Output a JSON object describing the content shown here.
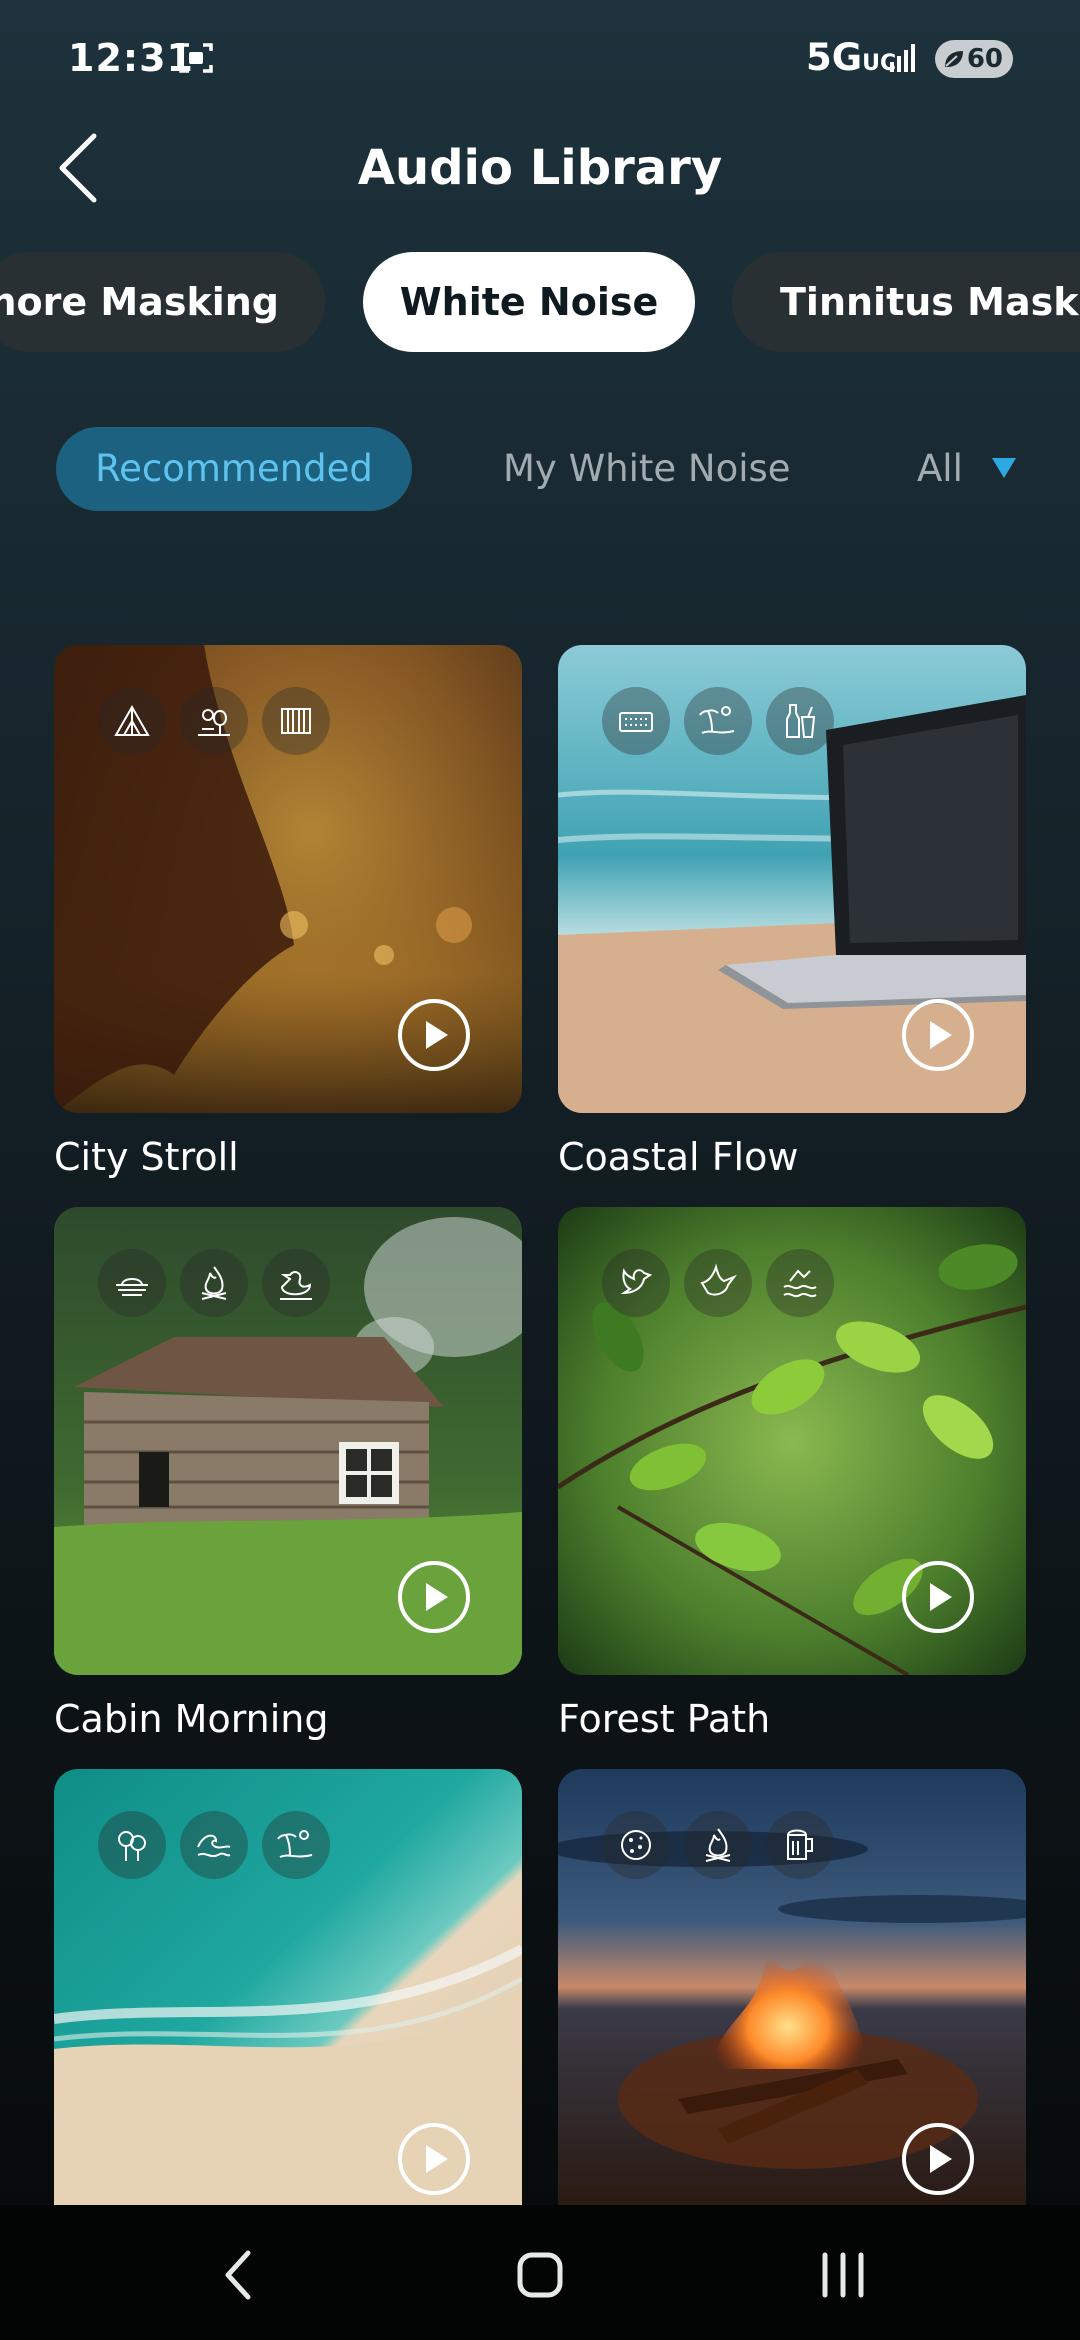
{
  "status": {
    "time": "12:31",
    "network": "5G",
    "network_sub": "UC",
    "battery": "60"
  },
  "header": {
    "title": "Audio Library"
  },
  "categories": [
    "nore Masking",
    "White Noise",
    "Tinnitus Maskin"
  ],
  "filters": {
    "recommended": "Recommended",
    "mine": "My White Noise",
    "all": "All"
  },
  "sounds": [
    {
      "name": "City Stroll",
      "icons": [
        "tent-icon",
        "park-icon",
        "accordion-icon"
      ]
    },
    {
      "name": "Coastal Flow",
      "icons": [
        "keyboard-icon",
        "beach-icon",
        "drinks-icon"
      ]
    },
    {
      "name": "Cabin Morning",
      "icons": [
        "sunrise-icon",
        "fire-icon",
        "duck-icon"
      ]
    },
    {
      "name": "Forest Path",
      "icons": [
        "bird-icon",
        "dove-icon",
        "stream-icon"
      ]
    },
    {
      "name": "",
      "icons": [
        "tree-icon",
        "wave-icon",
        "beach-icon"
      ]
    },
    {
      "name": "",
      "icons": [
        "cookie-icon",
        "fire-icon",
        "beer-icon"
      ]
    }
  ]
}
